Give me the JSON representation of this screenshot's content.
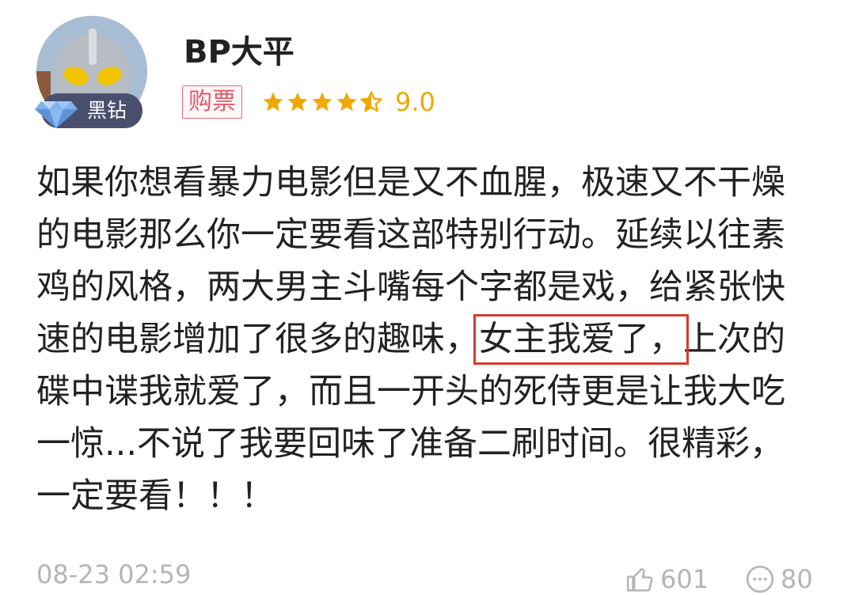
{
  "user": {
    "name": "BP大平",
    "badge": "黑钻",
    "avatar_icon": "ultraman-avatar-icon",
    "badge_icon": "diamond-icon"
  },
  "rating": {
    "tag": "购票",
    "stars": 4.5,
    "max_stars": 5,
    "score": "9.0",
    "star_color": "#f0a800"
  },
  "review": {
    "lines": [
      {
        "text": "如果你想看暴力电影但是又不血腥，极速又不干燥"
      },
      {
        "text": "的电影那么你一定要看这部特别行动。延续以往素"
      },
      {
        "text": "鸡的风格，两大男主斗嘴每个字都是戏，给紧张快"
      },
      {
        "before": "速的电影增加了很多的趣味，",
        "highlight": "女主我爱了，",
        "after": "上次的"
      },
      {
        "text": "碟中谍我就爱了，而且一开头的死侍更是让我大吃"
      },
      {
        "text": "一惊...不说了我要回味了准备二刷时间。很精彩，"
      },
      {
        "text": "一定要看！！！"
      }
    ],
    "highlight_color": "#d83a2f"
  },
  "footer": {
    "time": "08-23 02:59",
    "like_count": "601",
    "comment_count": "80",
    "like_icon": "thumbs-up-icon",
    "comment_icon": "comment-icon"
  }
}
